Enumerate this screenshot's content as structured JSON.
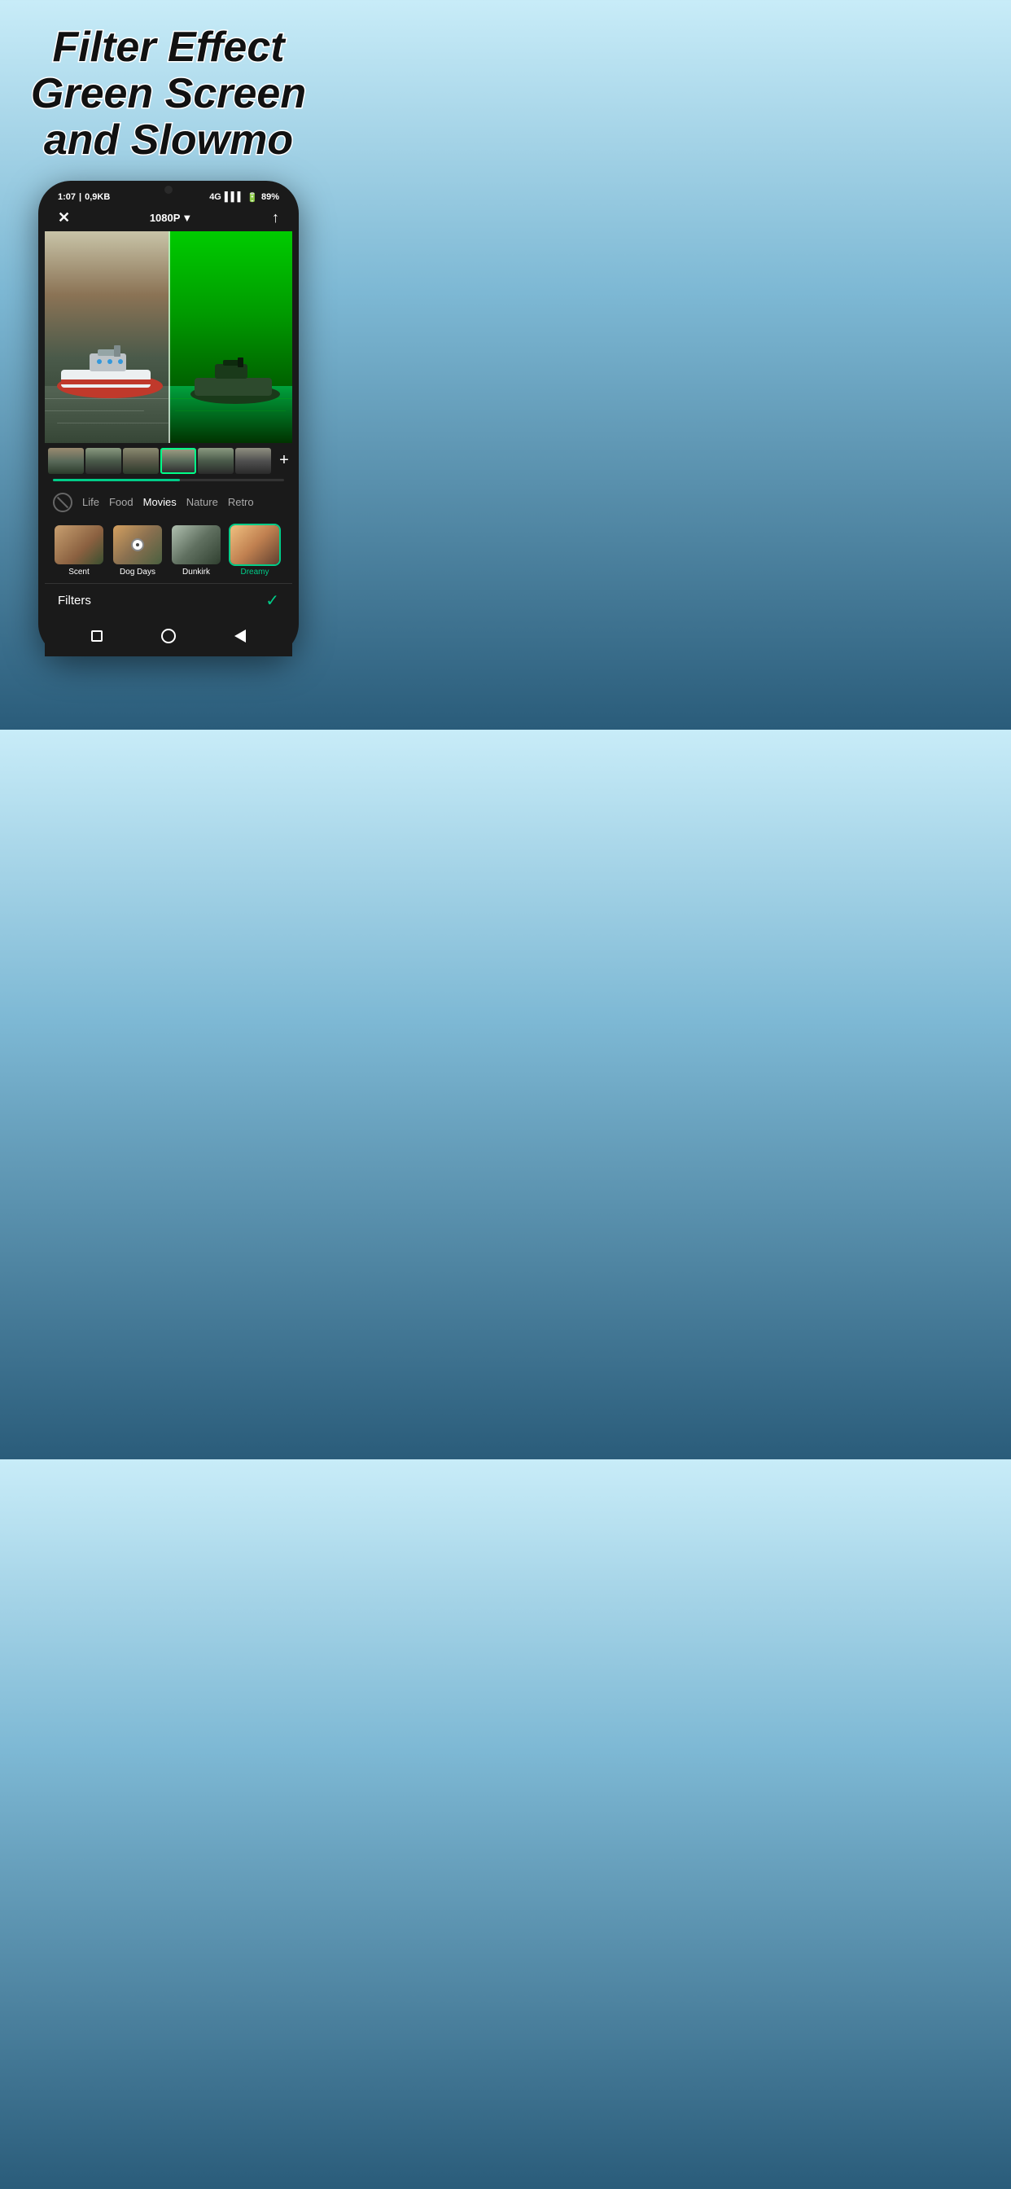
{
  "header": {
    "line1": "Filter Effect",
    "line2": "Green Screen and Slowmo"
  },
  "phone_status": {
    "time": "1:07",
    "data_usage": "0,9KB",
    "signal": "4G",
    "battery": "89%"
  },
  "toolbar": {
    "close_icon": "✕",
    "resolution": "1080P",
    "resolution_arrow": "▼",
    "export_icon": "↑"
  },
  "timeline": {
    "add_label": "+"
  },
  "filter_categories": {
    "no_filter_icon": "no-filter",
    "items": [
      {
        "label": "Life",
        "active": false
      },
      {
        "label": "Food",
        "active": false
      },
      {
        "label": "Movies",
        "active": true
      },
      {
        "label": "Nature",
        "active": false
      },
      {
        "label": "Retro",
        "active": false
      }
    ]
  },
  "filter_items": [
    {
      "label": "Scent",
      "selected": false,
      "bg_class": "ft-scent"
    },
    {
      "label": "Dog Days",
      "selected": false,
      "bg_class": "ft-dogdays",
      "has_indicator": true
    },
    {
      "label": "Dunkirk",
      "selected": false,
      "bg_class": "ft-dunkirk"
    },
    {
      "label": "Dreamy",
      "selected": true,
      "bg_class": "ft-dreamy"
    }
  ],
  "bottom_bar": {
    "title": "Filters",
    "checkmark": "✓"
  },
  "android_nav": {
    "square": "square",
    "circle": "circle",
    "triangle": "triangle"
  }
}
